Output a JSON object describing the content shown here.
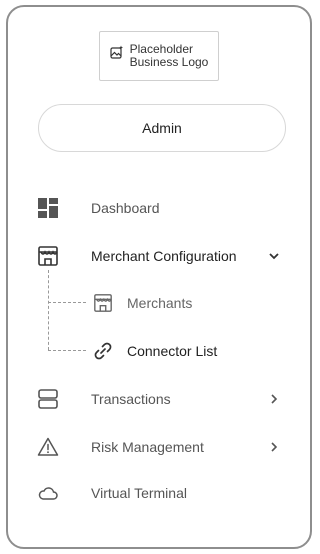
{
  "logo": {
    "line1": "Placeholder",
    "line2": "Business Logo",
    "icon": "image-sparkle-icon"
  },
  "user": {
    "name": "Admin"
  },
  "nav": {
    "dashboard": {
      "label": "Dashboard",
      "icon": "dashboard-icon"
    },
    "merchant_configuration": {
      "label": "Merchant Configuration",
      "icon": "storefront-icon",
      "expanded": true,
      "children": [
        {
          "label": "Merchants",
          "icon": "storefront-icon"
        },
        {
          "label": "Connector List",
          "icon": "link-icon",
          "current": true
        }
      ]
    },
    "transactions": {
      "label": "Transactions",
      "icon": "server-icon"
    },
    "risk_management": {
      "label": "Risk Management",
      "icon": "warning-icon"
    },
    "virtual_terminal": {
      "label": "Virtual Terminal",
      "icon": "cloud-icon"
    }
  },
  "colors": {
    "border": "#8e8e8e",
    "text": "#555555",
    "active_text": "#222222"
  }
}
